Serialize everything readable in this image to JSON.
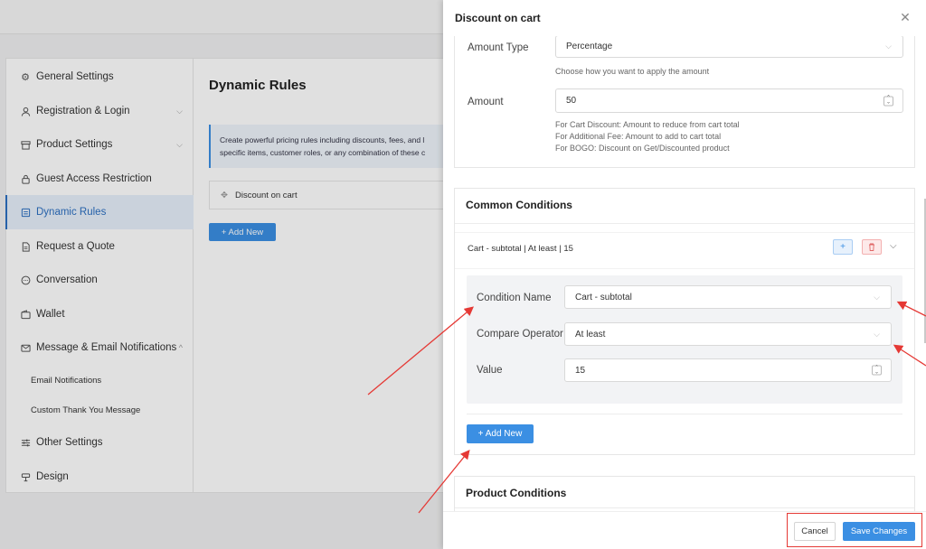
{
  "sidebar": {
    "items": [
      {
        "label": "General Settings",
        "icon": "gear-icon"
      },
      {
        "label": "Registration & Login",
        "icon": "user-icon",
        "chevron": true
      },
      {
        "label": "Product Settings",
        "icon": "box-icon",
        "chevron": true
      },
      {
        "label": "Guest Access Restriction",
        "icon": "lock-icon"
      },
      {
        "label": "Dynamic Rules",
        "icon": "rules-icon",
        "active": true
      },
      {
        "label": "Request a Quote",
        "icon": "document-icon"
      },
      {
        "label": "Conversation",
        "icon": "chat-icon"
      },
      {
        "label": "Wallet",
        "icon": "wallet-icon"
      },
      {
        "label": "Message & Email Notifications",
        "icon": "mail-icon",
        "chevron": true
      }
    ],
    "subitems": [
      "Email Notifications",
      "Custom Thank You Message"
    ],
    "items_bottom": [
      {
        "label": "Other Settings",
        "icon": "sliders-icon"
      },
      {
        "label": "Design",
        "icon": "palette-icon"
      }
    ]
  },
  "main": {
    "title": "Dynamic Rules",
    "info_line1": "Create powerful pricing rules including discounts, fees, and l",
    "info_line2": "specific items, customer roles, or any combination of these c",
    "rule_name": "Discount on cart",
    "add_new": "+ Add New"
  },
  "drawer": {
    "title": "Discount on cart",
    "amount_type_label": "Amount Type",
    "amount_type_value": "Percentage",
    "amount_type_help": "Choose how you want to apply the amount",
    "amount_label": "Amount",
    "amount_value": "50",
    "amount_help": [
      "For Cart Discount: Amount to reduce from cart total",
      "For Additional Fee: Amount to add to cart total",
      "For BOGO: Discount on Get/Discounted product"
    ],
    "common_conditions_title": "Common Conditions",
    "condition_summary": "Cart - subtotal | At least | 15",
    "condition_name_label": "Condition Name",
    "condition_name_value": "Cart - subtotal",
    "compare_operator_label": "Compare Operator",
    "compare_operator_value": "At least",
    "value_label": "Value",
    "value_value": "15",
    "add_new": "+ Add New",
    "product_conditions_title": "Product Conditions",
    "cancel": "Cancel",
    "save": "Save Changes"
  },
  "colors": {
    "accent": "#3b8fe3",
    "annotation": "#e53935"
  }
}
